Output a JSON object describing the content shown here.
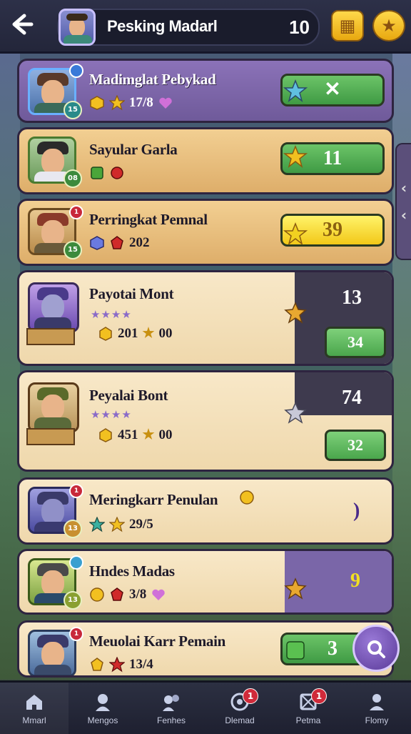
{
  "header": {
    "title": "Pesking Madarl",
    "count": "10",
    "back_icon": "arrow-left-icon",
    "btn_left_icon": "chest-icon",
    "btn_right_icon": "star-face-icon"
  },
  "cards": [
    {
      "name": "Madimglat Pebykad",
      "badge": "15",
      "stat": "17/8",
      "button": "✕"
    },
    {
      "name": "Sayular Garla",
      "badge": "08",
      "stat": "",
      "button": "11"
    },
    {
      "name": "Perringkat Pemnal",
      "badge": "15",
      "notif": "1",
      "stat": "202",
      "button": "39"
    },
    {
      "name": "Payotai Mont",
      "stat1": "201",
      "stat2": "00",
      "score": "13",
      "button": "34",
      "stars": "★★★★"
    },
    {
      "name": "Peyalai Bont",
      "stat1": "451",
      "stat2": "00",
      "score": "74",
      "button": "32",
      "stars": "★★★★"
    },
    {
      "name": "Meringkarr Penulan",
      "badge": "13",
      "notif": "1",
      "stat": "29/5",
      "score": ")"
    },
    {
      "name": "Hndes Madas",
      "badge": "13",
      "stat": "3/8",
      "score": "9"
    },
    {
      "name": "Meuolai Karr Pemain",
      "badge": "",
      "notif": "1",
      "stat": "13/4",
      "button": "3"
    }
  ],
  "bottom_nav": [
    {
      "label": "Mmarl",
      "icon": "home-icon"
    },
    {
      "label": "Mengos",
      "icon": "profile-icon"
    },
    {
      "label": "Fenhes",
      "icon": "friends-icon"
    },
    {
      "label": "Dlemad",
      "icon": "target-icon",
      "badge": "1"
    },
    {
      "label": "Petma",
      "icon": "card-icon",
      "badge": "1"
    },
    {
      "label": "Flomy",
      "icon": "user-icon"
    }
  ],
  "colors": {
    "accent_green": "#4aa64c",
    "accent_yellow": "#f2c818",
    "purple": "#7a66a8",
    "tan": "#deae6a"
  }
}
